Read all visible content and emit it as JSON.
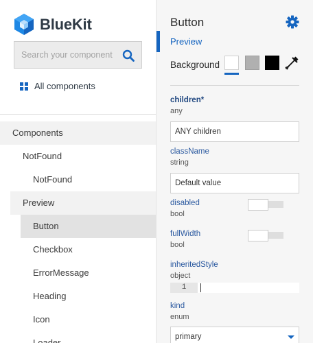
{
  "sidebar": {
    "logo_text": "BlueKit",
    "search_placeholder": "Search your component",
    "all_components_label": "All components",
    "tree": [
      {
        "label": "Components",
        "level": 0
      },
      {
        "label": "NotFound",
        "level": 1
      },
      {
        "label": "NotFound",
        "level": 2
      },
      {
        "label": "Preview",
        "level": 1,
        "expanded": true
      },
      {
        "label": "Button",
        "level": 2,
        "selected": true
      },
      {
        "label": "Checkbox",
        "level": 2
      },
      {
        "label": "ErrorMessage",
        "level": 2
      },
      {
        "label": "Heading",
        "level": 2
      },
      {
        "label": "Icon",
        "level": 2
      },
      {
        "label": "Loader",
        "level": 2
      }
    ]
  },
  "panel": {
    "title": "Button",
    "preview_tab": "Preview",
    "background_label": "Background",
    "background_swatches": [
      "#ffffff",
      "#b0b0b0",
      "#000000"
    ],
    "props": {
      "children": {
        "name": "children*",
        "type": "any",
        "value": "ANY children"
      },
      "className": {
        "name": "className",
        "type": "string",
        "value": "Default value"
      },
      "disabled": {
        "name": "disabled",
        "type": "bool"
      },
      "fullWidth": {
        "name": "fullWidth",
        "type": "bool"
      },
      "inheritedStyle": {
        "name": "inheritedStyle",
        "type": "object",
        "line_number": "1"
      },
      "kind": {
        "name": "kind",
        "type": "enum",
        "value": "primary"
      }
    }
  },
  "colors": {
    "accent": "#1565c0",
    "logo": "#1e88e5",
    "selected_row": "#e2e2e2"
  }
}
